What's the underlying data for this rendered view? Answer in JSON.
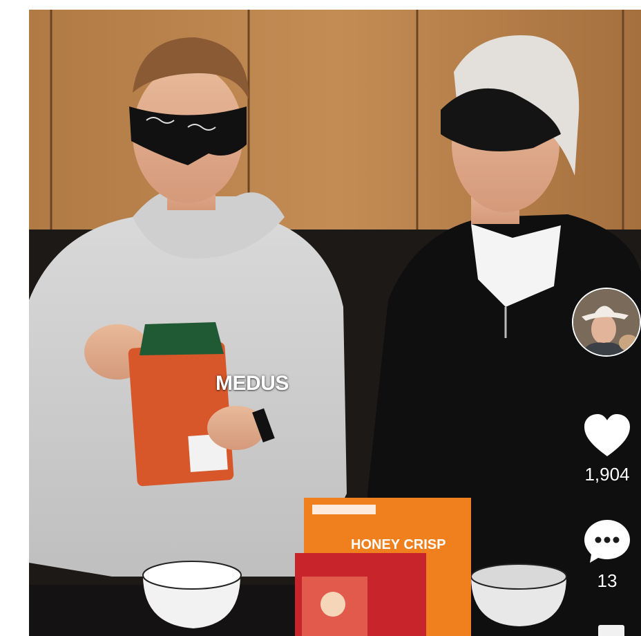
{
  "video": {
    "caption": "MEDUS",
    "product_box_label": "HONEY CRISP"
  },
  "actions": {
    "likes": "1,904",
    "comments": "13"
  },
  "colors": {
    "icon": "#ffffff",
    "caption": "#ffffff",
    "box_orange": "#f0801e"
  },
  "icons": [
    "heart-icon",
    "comment-bubble-icon",
    "share-icon"
  ]
}
